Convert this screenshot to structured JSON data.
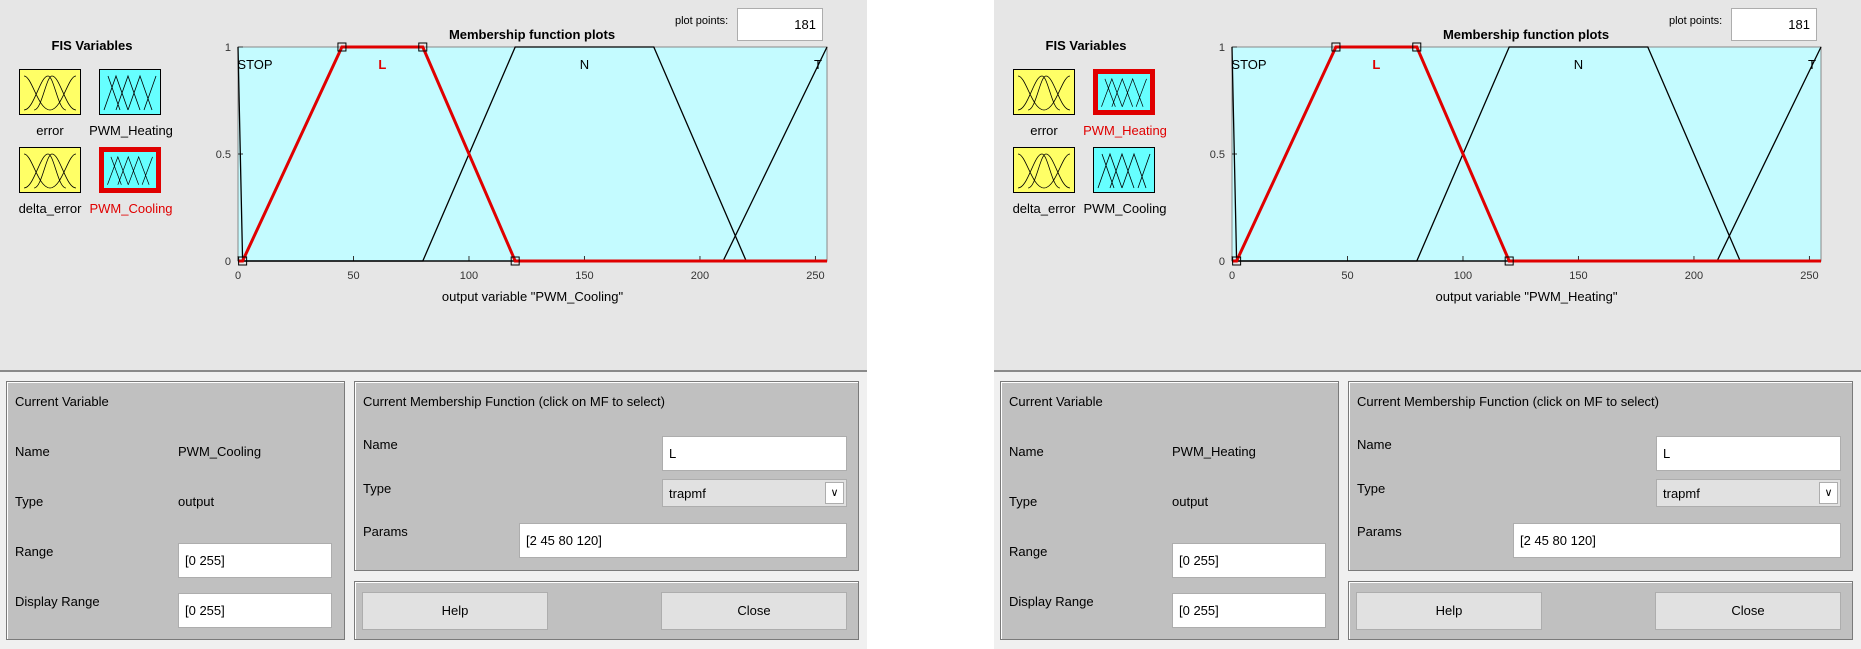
{
  "panels": [
    {
      "fis_title": "FIS Variables",
      "variables": [
        {
          "label": "error",
          "kind": "input",
          "selected": false
        },
        {
          "label": "PWM_Heating",
          "kind": "output",
          "selected": false
        },
        {
          "label": "delta_error",
          "kind": "input",
          "selected": false
        },
        {
          "label": "PWM_Cooling",
          "kind": "output",
          "selected": true
        }
      ],
      "plot_title": "Membership function plots",
      "plot_points_label": "plot points:",
      "plot_points_value": "181",
      "chart_data": {
        "type": "line",
        "xlabel": "output variable \"PWM_Cooling\"",
        "xlim": [
          0,
          255
        ],
        "ylim": [
          0,
          1
        ],
        "xticks": [
          "0",
          "50",
          "100",
          "150",
          "200",
          "250"
        ],
        "yticks": [
          "0",
          "0.5",
          "1"
        ],
        "series": [
          {
            "name": "STOP",
            "values": [
              [
                0,
                1
              ],
              [
                2,
                0
              ],
              [
                255,
                0
              ]
            ],
            "selected": false
          },
          {
            "name": "L",
            "values": [
              [
                0,
                0
              ],
              [
                2,
                0
              ],
              [
                45,
                1
              ],
              [
                80,
                1
              ],
              [
                120,
                0
              ],
              [
                255,
                0
              ]
            ],
            "selected": true
          },
          {
            "name": "N",
            "values": [
              [
                0,
                0
              ],
              [
                80,
                0
              ],
              [
                120,
                1
              ],
              [
                180,
                1
              ],
              [
                220,
                0
              ],
              [
                255,
                0
              ]
            ],
            "selected": false
          },
          {
            "name": "T",
            "values": [
              [
                0,
                0
              ],
              [
                210,
                0
              ],
              [
                255,
                1
              ]
            ],
            "selected": false
          }
        ]
      },
      "current_variable": {
        "title": "Current Variable",
        "name_label": "Name",
        "name_value": "PWM_Cooling",
        "type_label": "Type",
        "type_value": "output",
        "range_label": "Range",
        "range_value": "[0 255]",
        "display_range_label": "Display Range",
        "display_range_value": "[0 255]"
      },
      "current_mf": {
        "title": "Current Membership Function (click on MF to select)",
        "name_label": "Name",
        "name_value": "L",
        "type_label": "Type",
        "type_value": "trapmf",
        "params_label": "Params",
        "params_value": "[2 45 80 120]"
      },
      "help_label": "Help",
      "close_label": "Close"
    },
    {
      "fis_title": "FIS Variables",
      "variables": [
        {
          "label": "error",
          "kind": "input",
          "selected": false
        },
        {
          "label": "PWM_Heating",
          "kind": "output",
          "selected": true
        },
        {
          "label": "delta_error",
          "kind": "input",
          "selected": false
        },
        {
          "label": "PWM_Cooling",
          "kind": "output",
          "selected": false
        }
      ],
      "plot_title": "Membership function plots",
      "plot_points_label": "plot points:",
      "plot_points_value": "181",
      "chart_data": {
        "type": "line",
        "xlabel": "output variable \"PWM_Heating\"",
        "xlim": [
          0,
          255
        ],
        "ylim": [
          0,
          1
        ],
        "xticks": [
          "0",
          "50",
          "100",
          "150",
          "200",
          "250"
        ],
        "yticks": [
          "0",
          "0.5",
          "1"
        ],
        "series": [
          {
            "name": "STOP",
            "values": [
              [
                0,
                1
              ],
              [
                2,
                0
              ],
              [
                255,
                0
              ]
            ],
            "selected": false
          },
          {
            "name": "L",
            "values": [
              [
                0,
                0
              ],
              [
                2,
                0
              ],
              [
                45,
                1
              ],
              [
                80,
                1
              ],
              [
                120,
                0
              ],
              [
                255,
                0
              ]
            ],
            "selected": true
          },
          {
            "name": "N",
            "values": [
              [
                0,
                0
              ],
              [
                80,
                0
              ],
              [
                120,
                1
              ],
              [
                180,
                1
              ],
              [
                220,
                0
              ],
              [
                255,
                0
              ]
            ],
            "selected": false
          },
          {
            "name": "T",
            "values": [
              [
                0,
                0
              ],
              [
                210,
                0
              ],
              [
                255,
                1
              ]
            ],
            "selected": false
          }
        ]
      },
      "current_variable": {
        "title": "Current Variable",
        "name_label": "Name",
        "name_value": "PWM_Heating",
        "type_label": "Type",
        "type_value": "output",
        "range_label": "Range",
        "range_value": "[0 255]",
        "display_range_label": "Display Range",
        "display_range_value": "[0 255]"
      },
      "current_mf": {
        "title": "Current Membership Function (click on MF to select)",
        "name_label": "Name",
        "name_value": "L",
        "type_label": "Type",
        "type_value": "trapmf",
        "params_label": "Params",
        "params_value": "[2 45 80 120]"
      },
      "help_label": "Help",
      "close_label": "Close"
    }
  ],
  "colors": {
    "plot_bg": "#c4fbff",
    "input_var_bg": "#ffff66",
    "output_var_bg": "#66ffff",
    "selected": "#e00000",
    "group_bg": "#c0c0c0"
  }
}
